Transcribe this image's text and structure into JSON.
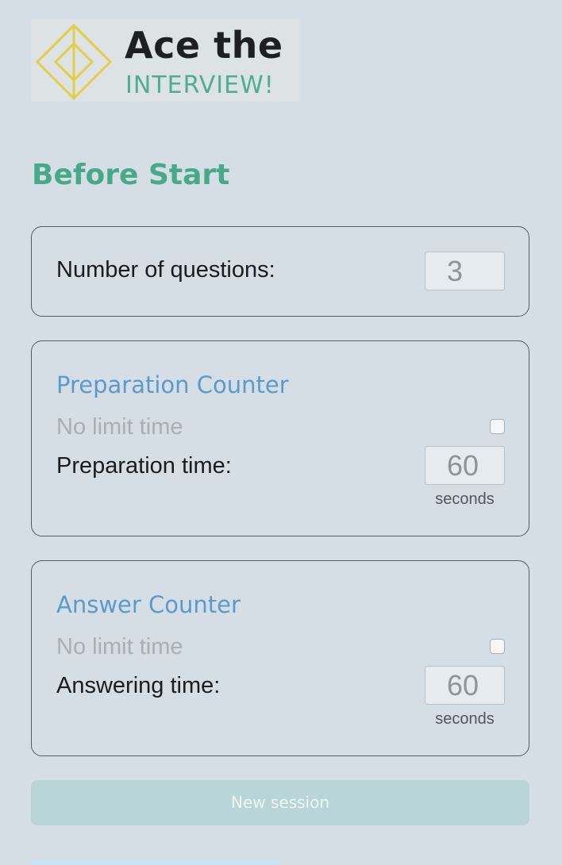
{
  "logo": {
    "line1": "Ace the",
    "line2": "INTERVIEW!",
    "icon": "nested-diamonds-logo",
    "colors": {
      "diamond": "#e2cf45",
      "title": "#1d1f22",
      "subtitle": "#4fae91"
    }
  },
  "page_title": "Before Start",
  "questions": {
    "label": "Number of questions:",
    "value": "3"
  },
  "preparation": {
    "heading": "Preparation Counter",
    "no_limit_label": "No limit time",
    "no_limit_checked": false,
    "time_label": "Preparation time:",
    "time_value": "60",
    "unit": "seconds"
  },
  "answer": {
    "heading": "Answer Counter",
    "no_limit_label": "No limit time",
    "no_limit_checked": false,
    "time_label": "Answering time:",
    "time_value": "60",
    "unit": "seconds"
  },
  "new_session_button": "New session",
  "colors": {
    "background": "#d5dde5",
    "title_green": "#48a98a",
    "heading_blue": "#5b9bcb",
    "button_bg": "#bad5d7"
  }
}
